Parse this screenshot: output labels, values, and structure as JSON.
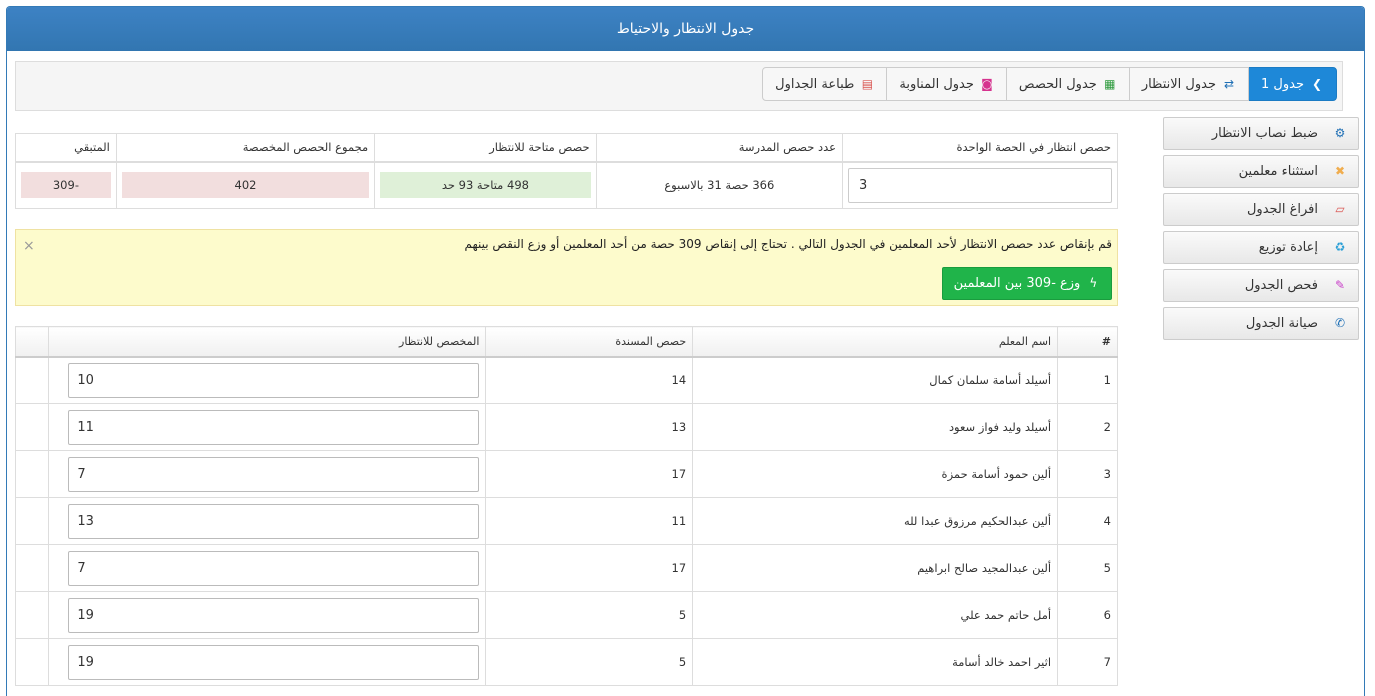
{
  "page": {
    "title": "جدول الانتظار والاحتياط"
  },
  "toolbar": {
    "buttons": [
      {
        "label": "جدول 1",
        "icon": "chevron-right-icon"
      },
      {
        "label": "جدول الانتظار",
        "icon": "refresh-icon"
      },
      {
        "label": "جدول الحصص",
        "icon": "table-icon"
      },
      {
        "label": "جدول المناوبة",
        "icon": "badge-icon"
      },
      {
        "label": "طباعة الجداول",
        "icon": "pdf-icon"
      }
    ]
  },
  "sidebar": {
    "items": [
      {
        "label": "ضبط نصاب الانتظار",
        "icon": "gear-icon"
      },
      {
        "label": "استثناء معلمين",
        "icon": "user-remove-icon"
      },
      {
        "label": "افراغ الجدول",
        "icon": "eraser-icon"
      },
      {
        "label": "إعادة توزيع",
        "icon": "recycle-icon"
      },
      {
        "label": "فحص الجدول",
        "icon": "magic-wand-icon"
      },
      {
        "label": "صيانة الجدول",
        "icon": "wrench-icon"
      }
    ]
  },
  "stats": {
    "headers": [
      "حصص انتظار في الحصة الواحدة",
      "عدد حصص المدرسة",
      "حصص متاحة للانتظار",
      "مجموع الحصص المخصصة",
      "المتبقي"
    ],
    "per_period_value": "3",
    "school_periods": "366 حصة 31 بالاسبوع",
    "available": "498 متاحة 93 حد",
    "total_allocated": "402",
    "remaining": "-309"
  },
  "alert": {
    "message": "قم بإنقاص عدد حصص الانتظار لأحد المعلمين في الجدول التالي . تحتاج إلى إنقاص 309 حصة من أحد المعلمين أو وزع النقص بينهم",
    "button": "وزع -309 بين المعلمين",
    "close": "×"
  },
  "teachers_table": {
    "headers": {
      "num": "#",
      "name": "اسم المعلم",
      "assigned": "حصص المسندة",
      "allocated": "المخصص للانتظار"
    },
    "rows": [
      {
        "num": "1",
        "name": "أسيلد أسامة سلمان كمال",
        "assigned": "14",
        "allocated": "10"
      },
      {
        "num": "2",
        "name": "أسيلد وليد فواز سعود",
        "assigned": "13",
        "allocated": "11"
      },
      {
        "num": "3",
        "name": "ألين حمود أسامة حمزة",
        "assigned": "17",
        "allocated": "7"
      },
      {
        "num": "4",
        "name": "ألين عبدالحكيم مرزوق عبدا لله",
        "assigned": "11",
        "allocated": "13"
      },
      {
        "num": "5",
        "name": "ألين عبدالمجيد صالح ابراهيم",
        "assigned": "17",
        "allocated": "7"
      },
      {
        "num": "6",
        "name": "أمل حاتم حمد علي",
        "assigned": "5",
        "allocated": "19"
      },
      {
        "num": "7",
        "name": "اثير احمد خالد أسامة",
        "assigned": "5",
        "allocated": "19"
      }
    ]
  },
  "colors": {
    "header": "#3a7ebf",
    "primary": "#1e88d8",
    "success": "#20b44a",
    "alert_bg": "#fdfbcc"
  }
}
